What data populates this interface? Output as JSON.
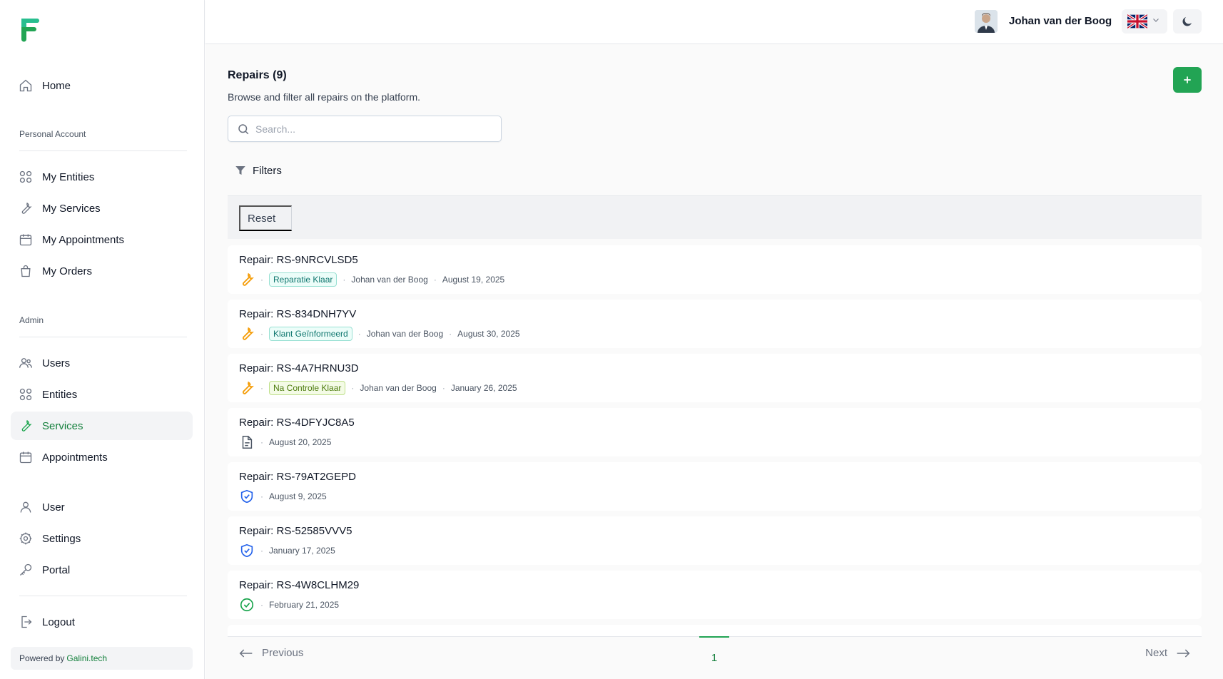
{
  "app": {
    "name": "Galini.tech portal"
  },
  "sidebar": {
    "home": "Home",
    "personal_title": "Personal Account",
    "personal_items": [
      "My Entities",
      "My Services",
      "My Appointments",
      "My Orders"
    ],
    "admin_title": "Admin",
    "admin_items": [
      "Users",
      "Entities",
      "Services",
      "Appointments"
    ],
    "account_items": [
      "User",
      "Settings",
      "Portal"
    ],
    "logout": "Logout",
    "powered_by": "Powered by",
    "powered_brand": "Galini.tech",
    "active_item": "Services"
  },
  "header": {
    "user_name": "Johan van der Boog",
    "language": "English (UK)"
  },
  "page": {
    "title": "Repairs (9)",
    "subtitle": "Browse and filter all repairs on the platform.",
    "search_placeholder": "Search...",
    "filters_label": "Filters",
    "reset_label": "Reset"
  },
  "repairs": [
    {
      "title": "Repair: RS-9NRCVLSD5",
      "icon": "wrench-icon",
      "status": "Reparatie Klaar",
      "status_color": "teal",
      "customer": "Johan van der Boog",
      "date": "August 19, 2025"
    },
    {
      "title": "Repair: RS-834DNH7YV",
      "icon": "wrench-icon",
      "status": "Klant Geïnformeerd",
      "status_color": "teal",
      "customer": "Johan van der Boog",
      "date": "August 30, 2025"
    },
    {
      "title": "Repair: RS-4A7HRNU3D",
      "icon": "wrench-icon",
      "status": "Na Controle Klaar",
      "status_color": "lime",
      "customer": "Johan van der Boog",
      "date": "January 26, 2025"
    },
    {
      "title": "Repair: RS-4DFYJC8A5",
      "icon": "document-icon",
      "status": "",
      "status_color": "",
      "customer": "",
      "date": "August 20, 2025"
    },
    {
      "title": "Repair: RS-79AT2GEPD",
      "icon": "shield-check-icon",
      "status": "",
      "status_color": "",
      "customer": "",
      "date": "August 9, 2025"
    },
    {
      "title": "Repair: RS-52585VVV5",
      "icon": "shield-check-icon",
      "status": "",
      "status_color": "",
      "customer": "",
      "date": "January 17, 2025"
    },
    {
      "title": "Repair: RS-4W8CLHM29",
      "icon": "check-circle-icon",
      "status": "",
      "status_color": "",
      "customer": "",
      "date": "February 21, 2025"
    }
  ],
  "pagination": {
    "previous": "Previous",
    "next": "Next",
    "current_page": "1"
  },
  "colors": {
    "brand": "#22a454",
    "active_text": "#15803d",
    "wrench": "#f59e0b",
    "shield": "#2563eb",
    "check": "#16a34a"
  }
}
